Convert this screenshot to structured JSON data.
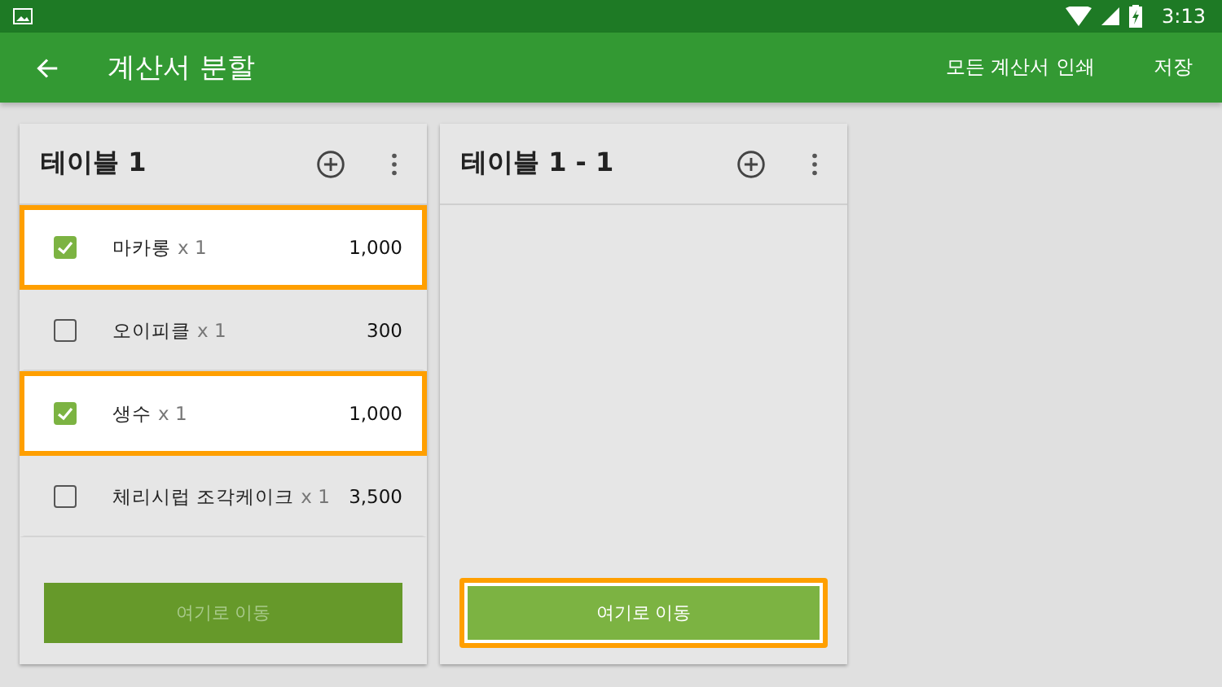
{
  "status_bar": {
    "time": "3:13"
  },
  "app_bar": {
    "title": "계산서 분할",
    "actions": [
      "모든 계산서 인쇄",
      "저장"
    ]
  },
  "panels": [
    {
      "title": "테이블 1",
      "items": [
        {
          "name": "마카롱",
          "quantity": "x 1",
          "price": "1,000",
          "checked": true
        },
        {
          "name": "오이피클",
          "quantity": "x 1",
          "price": "300",
          "checked": false
        },
        {
          "name": "생수",
          "quantity": "x 1",
          "price": "1,000",
          "checked": true
        },
        {
          "name": "체리시럽 조각케이크",
          "quantity": "x 1",
          "price": "3,500",
          "checked": false
        }
      ],
      "move_button": {
        "label": "여기로 이동",
        "disabled": true,
        "focused": false
      }
    },
    {
      "title": "테이블 1 - 1",
      "move_button": {
        "label": "여기로 이동",
        "disabled": false,
        "focused": true
      }
    }
  ]
}
